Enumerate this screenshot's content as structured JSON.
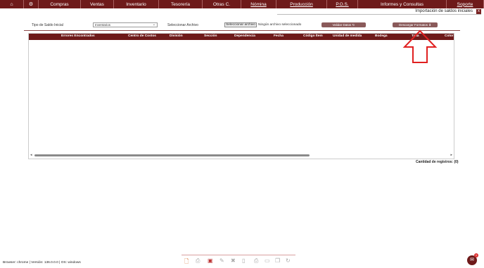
{
  "menu": {
    "home_icon": "home-icon",
    "gear_icon": "gear-icon",
    "compras": "Compras",
    "ventas": "Ventas",
    "inventario": "Inventario",
    "tesoreria": "Tesorería",
    "otras": "Otras C.",
    "nomina": "Nómina",
    "produccion": "Producción",
    "pos": "P.O.S.",
    "informes": "Informes y Consultas",
    "soporte": "Soporte"
  },
  "window": {
    "title": "Importación de saldos iniciales",
    "close": "x"
  },
  "form": {
    "tipo_label": "Tipo de Saldo Inicial",
    "tipo_value": "Inventarios",
    "archivo_label": "Seleccionar Archivo",
    "file_button": "Seleccionar archivo",
    "file_status": "Ningún archivo seleccionado",
    "validar_button": "Validar Datos",
    "descargar_button": "Descargar Formatos"
  },
  "grid": {
    "columns": [
      "Errores Encontrados",
      "Centro de Costos",
      "División",
      "Sección",
      "Dependencia",
      "Fecha",
      "Código Ítem",
      "Unidad de medida",
      "Bodega",
      "Talla",
      "Color"
    ]
  },
  "records": {
    "label": "Cantidad de registros:",
    "count": "(0)"
  },
  "footer": {
    "text": "Browser: chrome | Versión: 136.0.0.0 | OS: windows"
  },
  "chat": {
    "badge": "1"
  },
  "colors": {
    "brand": "#6e1a1a",
    "button": "#8a5a5a",
    "arrow": "#e02020"
  }
}
